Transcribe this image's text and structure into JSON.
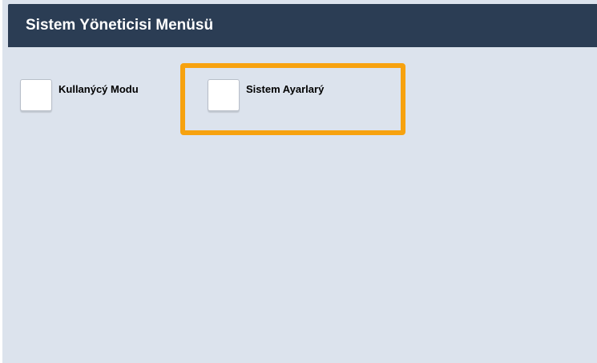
{
  "header": {
    "title": "Sistem Yöneticisi Menüsü"
  },
  "menu": {
    "items": [
      {
        "label": "Kullanýcý Modu"
      },
      {
        "label": "Sistem Ayarlarý"
      }
    ]
  },
  "colors": {
    "background": "#dce3ed",
    "title_bar": "#2b3d54",
    "highlight": "#f7a20f"
  }
}
